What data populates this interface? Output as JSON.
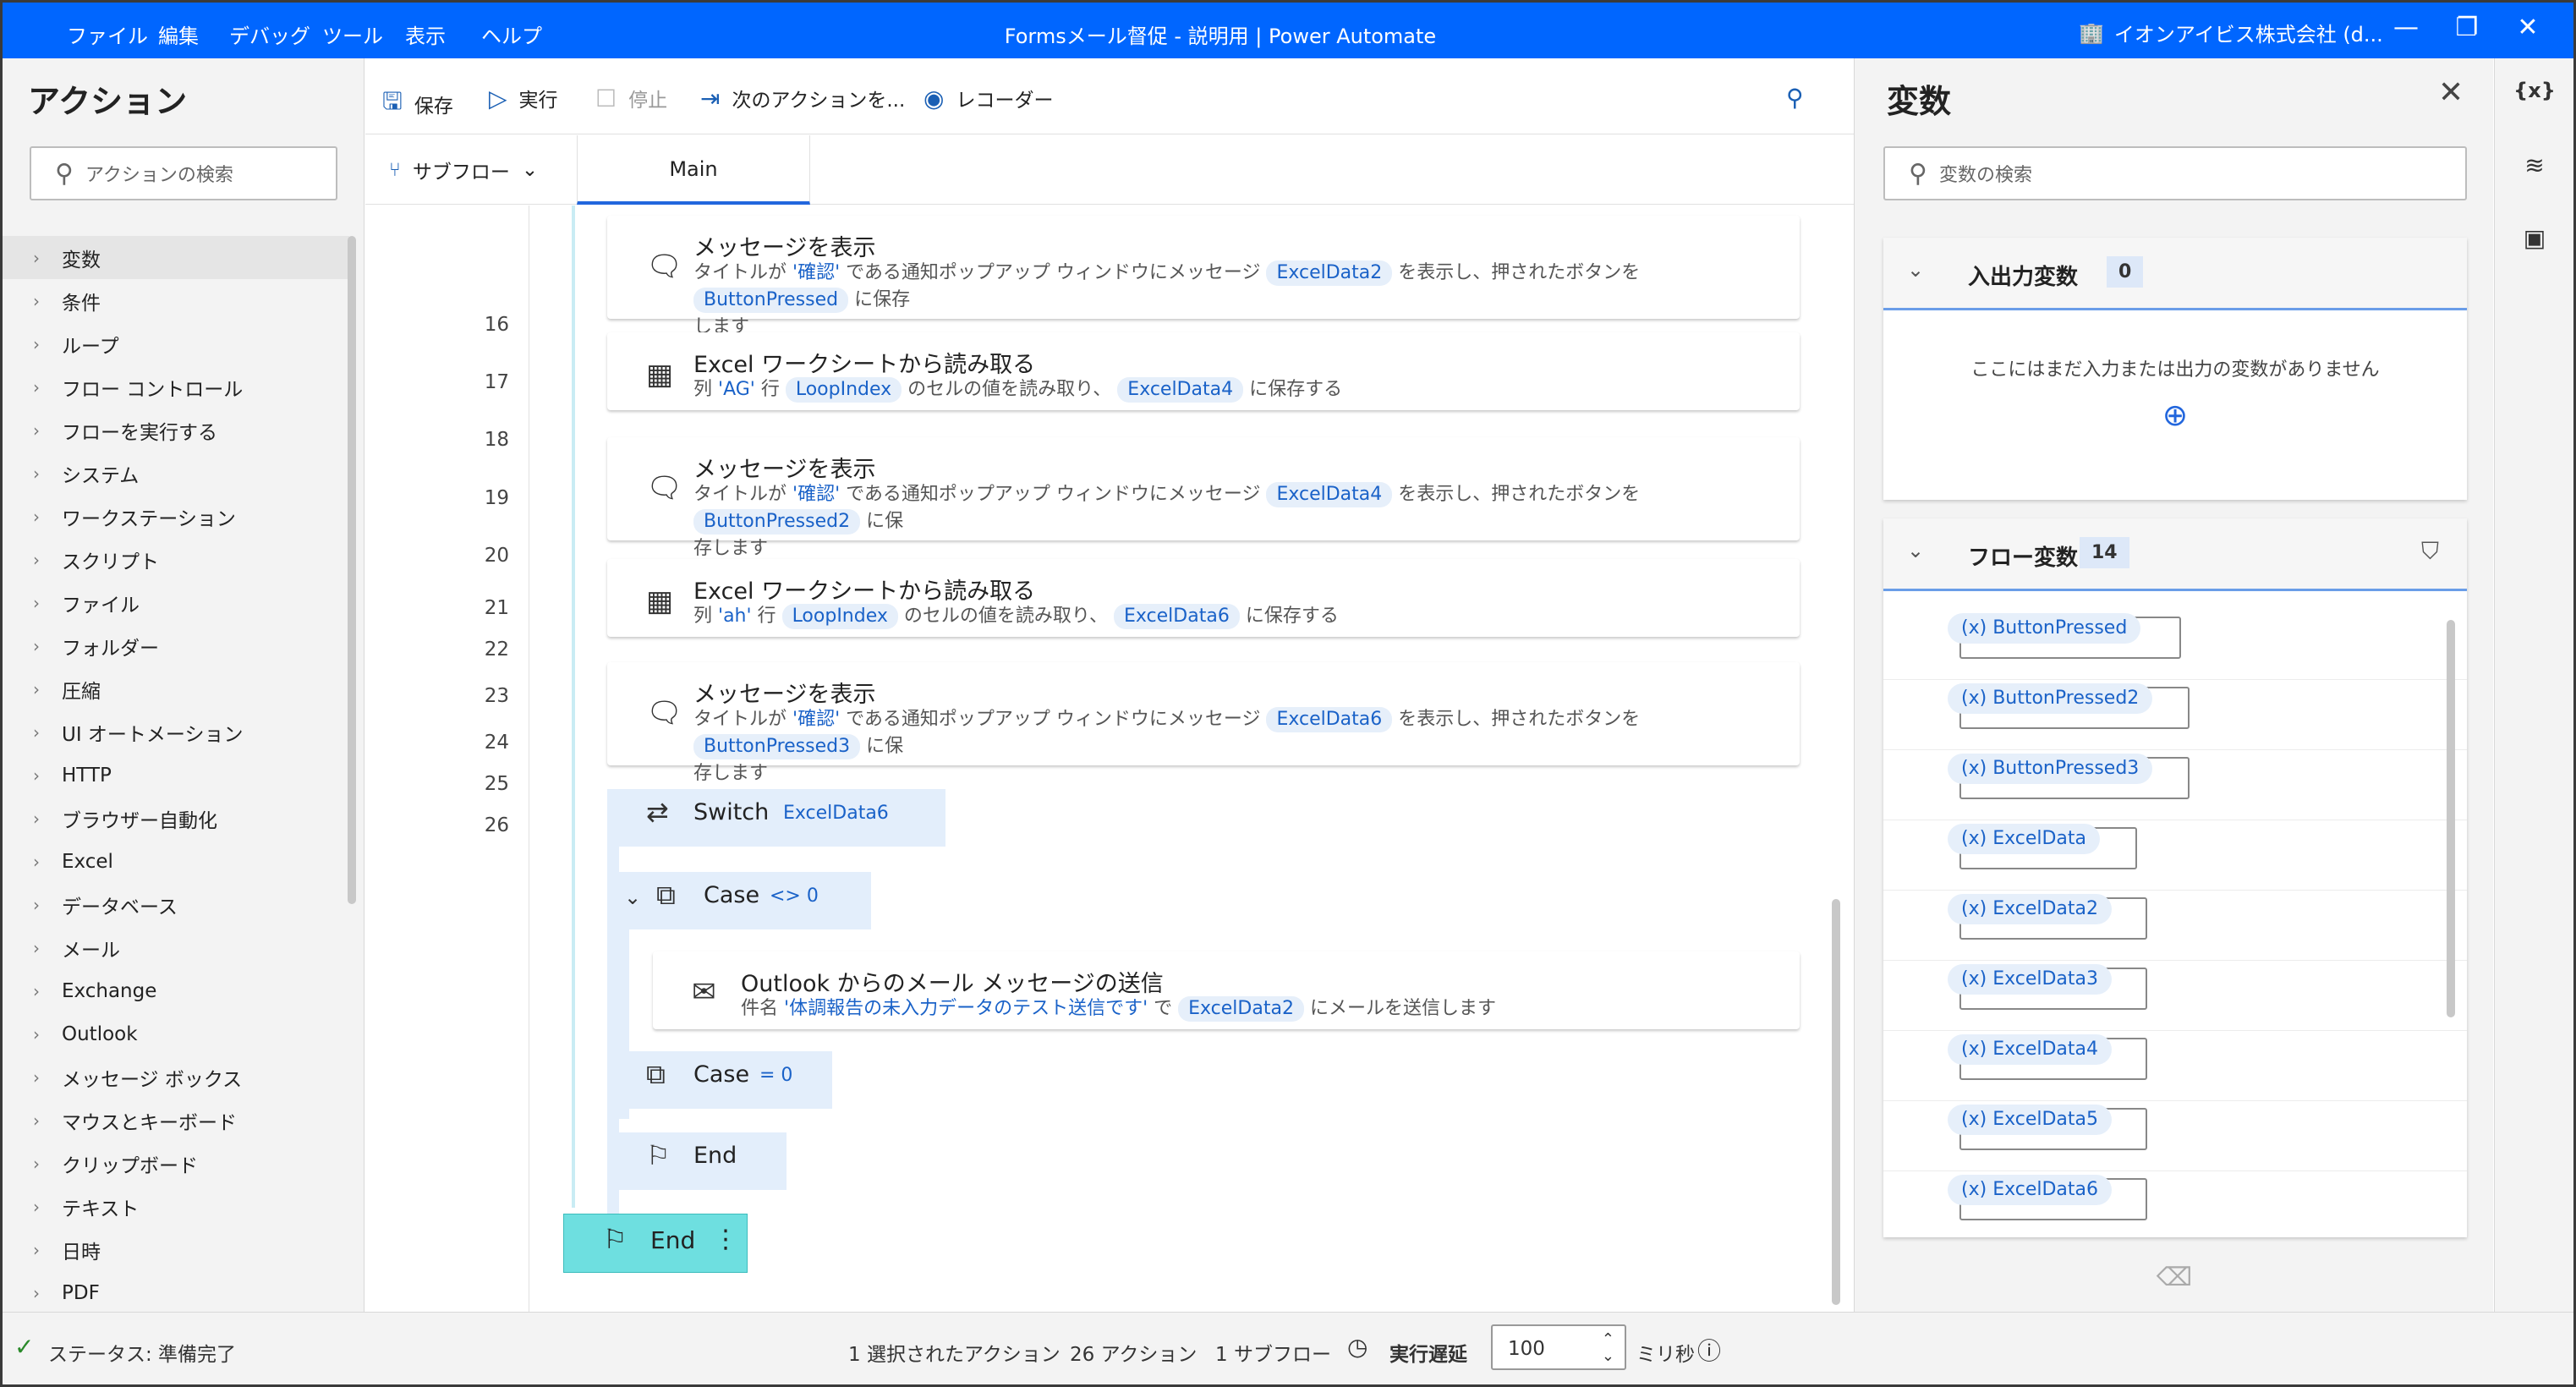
{
  "titlebar": {
    "menu": [
      "ファイル",
      "編集",
      "デバッグ",
      "ツール",
      "表示",
      "ヘルプ"
    ],
    "title": "Formsメール督促 - 説明用 | Power Automate",
    "account": "イオンアイビス株式会社 (d...",
    "minimize": "—",
    "maximize": "❐",
    "close": "✕"
  },
  "left": {
    "title": "アクション",
    "search_placeholder": "アクションの検索",
    "items": [
      "変数",
      "条件",
      "ループ",
      "フロー コントロール",
      "フローを実行する",
      "システム",
      "ワークステーション",
      "スクリプト",
      "ファイル",
      "フォルダー",
      "圧縮",
      "UI オートメーション",
      "HTTP",
      "ブラウザー自動化",
      "Excel",
      "データベース",
      "メール",
      "Exchange",
      "Outlook",
      "メッセージ ボックス",
      "マウスとキーボード",
      "クリップボード",
      "テキスト",
      "日時",
      "PDF"
    ]
  },
  "toolbar": {
    "save": "保存",
    "run": "実行",
    "stop": "停止",
    "next": "次のアクションを...",
    "recorder": "レコーダー"
  },
  "tabs": {
    "subflow": "サブフロー",
    "main": "Main"
  },
  "lines": [
    "16",
    "17",
    "18",
    "19",
    "20",
    "21",
    "22",
    "23",
    "24",
    "25",
    "26"
  ],
  "steps": {
    "s16": {
      "title": "メッセージを表示",
      "p1": "タイトルが",
      "q1": "'確認'",
      "p2": "である通知ポップアップ ウィンドウにメッセージ",
      "v1": "ExcelData2",
      "p3": "を表示し、押されたボタンを",
      "v2": "ButtonPressed",
      "p4": "に保存",
      "p5": "します"
    },
    "s17": {
      "title": "Excel ワークシートから読み取る",
      "p1": "列",
      "q1": "'AG'",
      "p2": "行",
      "v1": "LoopIndex",
      "p3": "のセルの値を読み取り、",
      "v2": "ExcelData4",
      "p4": "に保存する"
    },
    "s18": {
      "title": "メッセージを表示",
      "p1": "タイトルが",
      "q1": "'確認'",
      "p2": "である通知ポップアップ ウィンドウにメッセージ",
      "v1": "ExcelData4",
      "p3": "を表示し、押されたボタンを",
      "v2": "ButtonPressed2",
      "p4": "に保",
      "p5": "存します"
    },
    "s19": {
      "title": "Excel ワークシートから読み取る",
      "p1": "列",
      "q1": "'ah'",
      "p2": "行",
      "v1": "LoopIndex",
      "p3": "のセルの値を読み取り、",
      "v2": "ExcelData6",
      "p4": "に保存する"
    },
    "s20": {
      "title": "メッセージを表示",
      "p1": "タイトルが",
      "q1": "'確認'",
      "p2": "である通知ポップアップ ウィンドウにメッセージ",
      "v1": "ExcelData6",
      "p3": "を表示し、押されたボタンを",
      "v2": "ButtonPressed3",
      "p4": "に保",
      "p5": "存します"
    },
    "s21": {
      "title": "Switch",
      "v1": "ExcelData6"
    },
    "s22": {
      "title": "Case",
      "cond": "<> 0"
    },
    "s23": {
      "title": "Outlook からのメール メッセージの送信",
      "p1": "件名",
      "q1": "'体調報告の未入力データのテスト送信です'",
      "p2": "で",
      "v1": "ExcelData2",
      "p3": "にメールを送信します"
    },
    "s24": {
      "title": "Case",
      "cond": "= 0"
    },
    "s25": {
      "title": "End"
    },
    "s26": {
      "title": "End"
    }
  },
  "right": {
    "title": "変数",
    "search_placeholder": "変数の検索",
    "io": {
      "label": "入出力変数",
      "count": "0",
      "empty": "ここにはまだ入力または出力の変数がありません"
    },
    "flow": {
      "label": "フロー変数",
      "count": "14",
      "vars": [
        "ButtonPressed",
        "ButtonPressed2",
        "ButtonPressed3",
        "ExcelData",
        "ExcelData2",
        "ExcelData3",
        "ExcelData4",
        "ExcelData5",
        "ExcelData6"
      ]
    }
  },
  "strip": {
    "vars": "{x}"
  },
  "status": {
    "ready": "ステータス: 準備完了",
    "selected": "1 選択されたアクション",
    "actions": "26 アクション",
    "subflows": "1 サブフロー",
    "delay_label": "実行遅延",
    "delay_value": "100",
    "unit": "ミリ秒"
  }
}
